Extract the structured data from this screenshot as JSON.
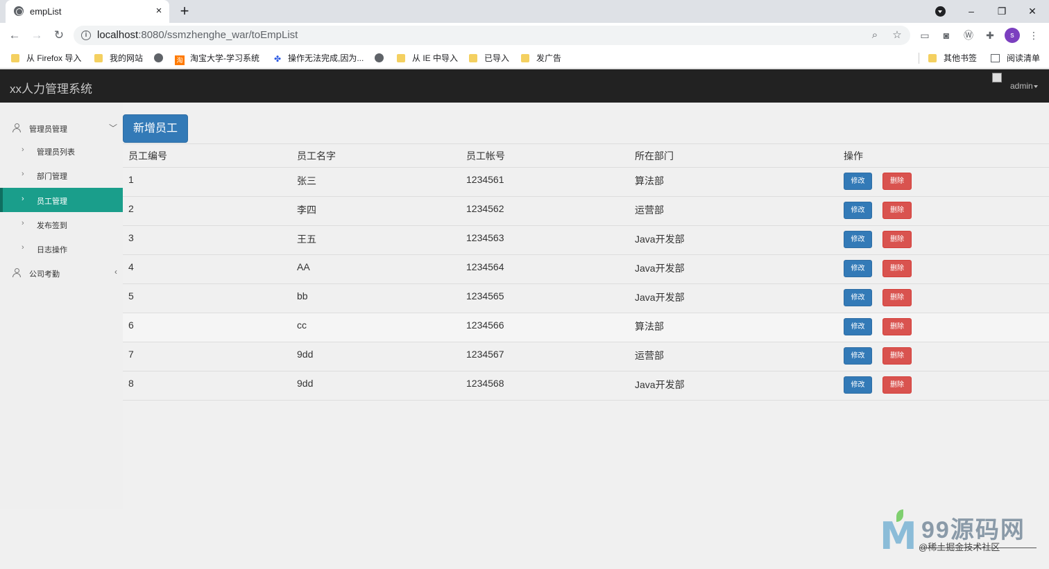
{
  "browser": {
    "tab_title": "empList",
    "tab_close": "×",
    "new_tab": "+",
    "url_host": "localhost",
    "url_rest": ":8080/ssmzhenghe_war/toEmpList",
    "window_minimize": "–",
    "window_restore": "❐",
    "window_close": "✕",
    "avatar_letter": "s",
    "bookmarks": [
      "从 Firefox 导入",
      "我的网站",
      "淘宝大学-学习系统",
      "操作无法完成,因为...",
      "从 IE 中导入",
      "已导入",
      "发广告"
    ],
    "bookmarks_right": [
      "其他书签",
      "阅读清单"
    ],
    "taobao_badge": "淘",
    "icons": [
      "globe-icon",
      "back-arrow-icon",
      "forward-arrow-icon",
      "reload-icon",
      "info-icon",
      "zoom-icon",
      "star-icon",
      "extensions-icon",
      "menu-icon"
    ]
  },
  "app": {
    "title": "xx人力管理系统",
    "user": "admin"
  },
  "sidebar": {
    "groups": [
      {
        "label": "管理员管理",
        "arrow": "﹀"
      },
      {
        "label": "公司考勤",
        "arrow": "‹"
      }
    ],
    "items": [
      {
        "label": "管理员列表"
      },
      {
        "label": "部门管理"
      },
      {
        "label": "员工管理"
      },
      {
        "label": "发布签到"
      },
      {
        "label": "日志操作"
      }
    ],
    "active_item": "员工管理",
    "chevron": "›"
  },
  "main": {
    "add_button": "新增员工",
    "columns": [
      "员工编号",
      "员工名字",
      "员工帐号",
      "所在部门",
      "操作"
    ],
    "edit_label": "修改",
    "delete_label": "删除",
    "rows": [
      [
        "1",
        "张三",
        "1234561",
        "算法部"
      ],
      [
        "2",
        "李四",
        "1234562",
        "运营部"
      ],
      [
        "3",
        "王五",
        "1234563",
        "Java开发部"
      ],
      [
        "4",
        "AA",
        "1234564",
        "Java开发部"
      ],
      [
        "5",
        "bb",
        "1234565",
        "Java开发部"
      ],
      [
        "6",
        "cc",
        "1234566",
        "算法部"
      ],
      [
        "7",
        "9dd",
        "1234567",
        "运营部"
      ],
      [
        "8",
        "9dd",
        "1234568",
        "Java开发部"
      ]
    ]
  },
  "watermark": {
    "name": "99源码网",
    "sub": "@稀土掘金技术社区"
  },
  "colors": {
    "header_bg": "#222222",
    "active_menu": "#1a9e8b",
    "primary": "#337ab7",
    "danger": "#d9534f"
  }
}
